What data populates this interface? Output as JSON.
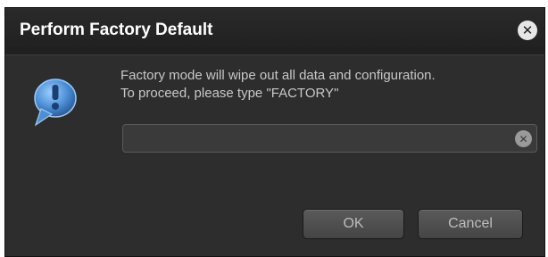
{
  "dialog": {
    "title": "Perform Factory Default",
    "close_icon": "close-circle-icon",
    "info_icon": "speech-bubble-exclamation-icon",
    "message_line1": "Factory mode will wipe out all data and configuration.",
    "message_line2": "To proceed, please type \"FACTORY\"",
    "input": {
      "value": "",
      "placeholder": ""
    },
    "clear_icon": "clear-circle-icon",
    "ok_label": "OK",
    "cancel_label": "Cancel"
  },
  "colors": {
    "dialog_bg": "#2d2d2d",
    "titlebar_bg": "#222222",
    "bubble_blue": "#4d8fd6",
    "text": "#c8c8c8"
  }
}
